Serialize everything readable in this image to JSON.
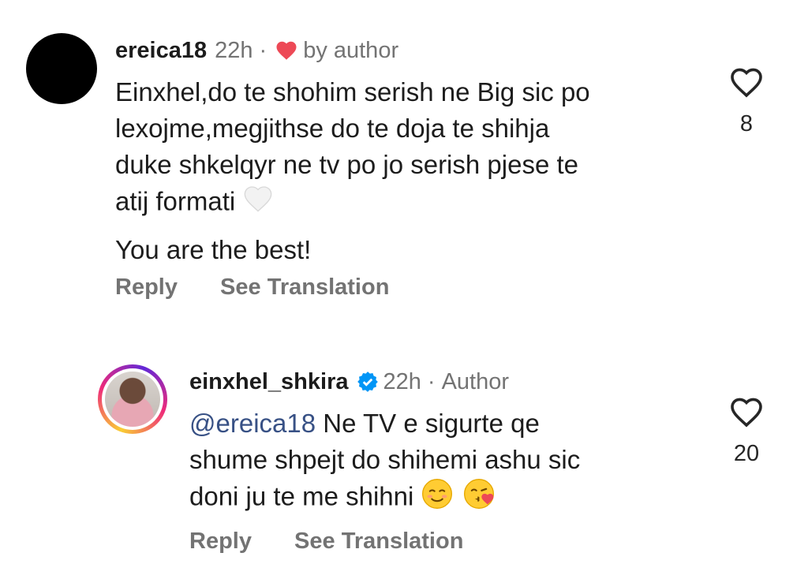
{
  "comments": [
    {
      "username": "ereica18",
      "time": "22h",
      "dot": "·",
      "badge": "by author",
      "lines": [
        "Einxhel,do te shohim serish ne Big sic po",
        "lexojme,megjithse do te doja te shihja",
        "duke shkelqyr ne tv po jo serish pjese te",
        "atij formati"
      ],
      "second_paragraph": "You are the best!",
      "like_count": "8",
      "reply_label": "Reply",
      "translate_label": "See Translation"
    },
    {
      "username": "einxhel_shkira",
      "time": "22h",
      "dot": "·",
      "badge": "Author",
      "mention": "@ereica18",
      "lines": [
        "Ne TV e sigurte qe",
        "shume shpejt do shihemi ashu sic",
        "doni ju te me shihni"
      ],
      "like_count": "20",
      "reply_label": "Reply",
      "translate_label": "See Translation"
    }
  ],
  "colors": {
    "accent_heart": "#ed4956",
    "verified_blue": "#0095f6",
    "mention": "#385185",
    "muted": "#737373"
  },
  "icons": [
    "heart-outline-icon",
    "heart-filled-icon",
    "white-heart-emoji",
    "verified-icon",
    "smiling-face-emoji",
    "face-blowing-kiss-emoji"
  ]
}
